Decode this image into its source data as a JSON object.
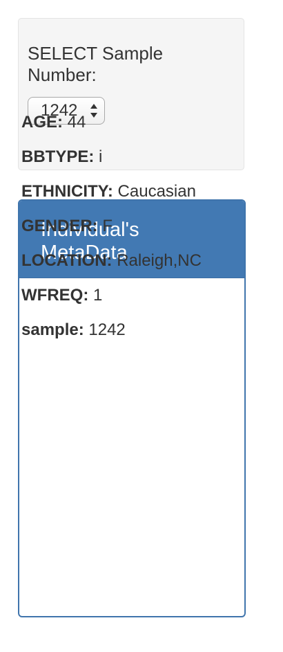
{
  "selector": {
    "label": "SELECT Sample Number:",
    "selected_value": "1242"
  },
  "panel": {
    "title": "Individual's MetaData",
    "items": [
      {
        "key": "AGE:",
        "value": " 44"
      },
      {
        "key": "BBTYPE:",
        "value": " i"
      },
      {
        "key": "ETHNICITY:",
        "value": " Caucasian"
      },
      {
        "key": "GENDER:",
        "value": " F"
      },
      {
        "key": "LOCATION:",
        "value": " Raleigh,NC"
      },
      {
        "key": "WFREQ:",
        "value": " 1"
      },
      {
        "key": "sample:",
        "value": " 1242"
      }
    ]
  },
  "colors": {
    "panel_heading": "#4279b3",
    "panel_border": "#3f74ac",
    "well_background": "#f5f5f5"
  }
}
